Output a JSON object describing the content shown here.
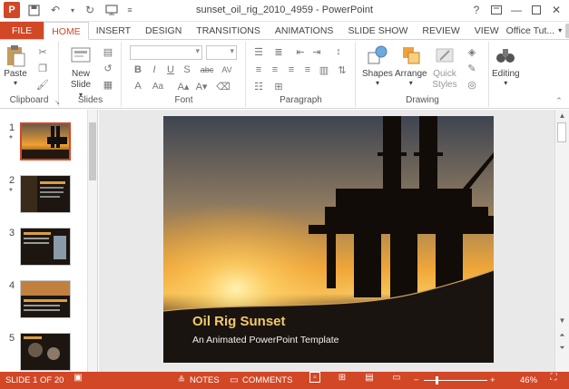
{
  "window": {
    "title": "sunset_oil_rig_2010_4959 - PowerPoint",
    "app_logo": "P",
    "help": "?",
    "controls": [
      "help-icon",
      "restore-ribbon-icon",
      "minimize-icon",
      "maximize-icon",
      "close-icon"
    ]
  },
  "ribbon_tabs": {
    "file": "FILE",
    "home": "HOME",
    "insert": "INSERT",
    "design": "DESIGN",
    "transitions": "TRANSITIONS",
    "animations": "ANIMATIONS",
    "slide_show": "SLIDE SHOW",
    "review": "REVIEW",
    "view": "VIEW",
    "account": "Office Tut..."
  },
  "ribbon": {
    "clipboard": {
      "paste": "Paste",
      "label": "Clipboard"
    },
    "slides": {
      "new_slide": "New Slide",
      "new_slide_caret": "▾",
      "label": "Slides"
    },
    "font": {
      "label": "Font",
      "bold": "B",
      "italic": "I",
      "underline": "U",
      "shadow": "S",
      "strike": "abc",
      "spacing": "AV",
      "color": "A",
      "size_toggle": "Aa"
    },
    "paragraph": {
      "label": "Paragraph"
    },
    "drawing": {
      "shapes": "Shapes",
      "arrange": "Arrange",
      "quick_styles": "Quick Styles",
      "label": "Drawing"
    },
    "editing": {
      "label": "Editing"
    }
  },
  "slides": [
    {
      "number": "1",
      "star": "*",
      "selected": true
    },
    {
      "number": "2",
      "star": "*"
    },
    {
      "number": "3"
    },
    {
      "number": "4"
    },
    {
      "number": "5"
    }
  ],
  "current_slide": {
    "title": "Oil Rig Sunset",
    "subtitle": "An Animated PowerPoint Template"
  },
  "status_bar": {
    "slide_indicator": "SLIDE 1 OF 20",
    "notes": "NOTES",
    "comments": "COMMENTS",
    "zoom": "46%",
    "zoom_fraction": 0.46
  },
  "colors": {
    "accent": "#d24726",
    "title_text": "#f2c96a"
  }
}
